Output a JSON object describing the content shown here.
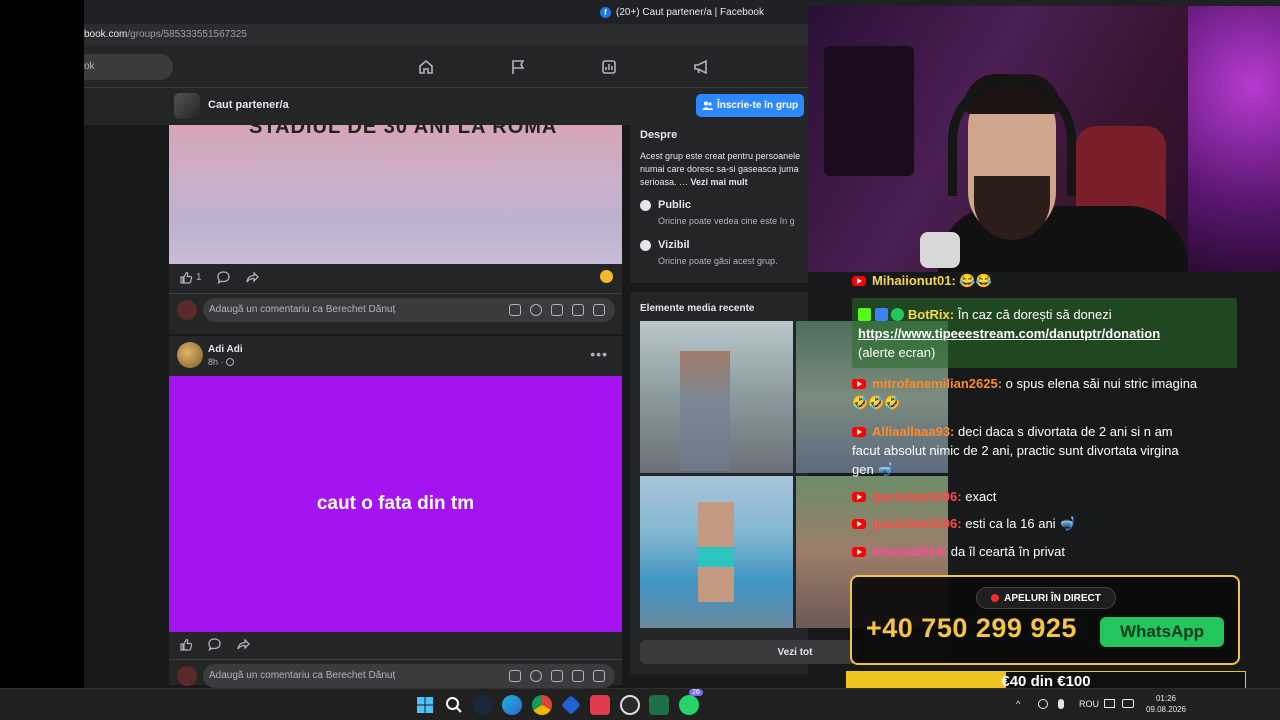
{
  "browser": {
    "tab_title": "(20+) Caut partener/a | Facebook",
    "url_host": "book.com",
    "url_path": "/groups/585333551567325",
    "search_placeholder": "ok"
  },
  "group": {
    "name": "Caut partener/a",
    "join_label": "Înscrie-te în grup"
  },
  "post1": {
    "image_caption": "STADIUL DE 30 ANI LA ROMA",
    "like_count": "1",
    "comment_placeholder": "Adaugă un comentariu ca Berechet Dănuț"
  },
  "post2": {
    "author": "Adi Adi",
    "time": "8h ·",
    "text": "caut o fata din tm",
    "comment_placeholder": "Adaugă un comentariu ca Berechet Dănuț"
  },
  "about": {
    "title": "Despre",
    "description_1": "Acest grup este creat pentru persoanele",
    "description_2": "numai care doresc sa-si gaseasca juma",
    "description_3": "serioasa. …",
    "see_more": "Vezi mai mult",
    "public_title": "Public",
    "public_text": "Oricine poate vedea cine este în g",
    "visible_title": "Vizibil",
    "visible_text": "Oricine poate găsi acest grup."
  },
  "media": {
    "title": "Elemente media recente",
    "see_all": "Vezi tot"
  },
  "chat": [
    {
      "user": "Mihaiionut01:",
      "text": "😂😂",
      "color": "#f6d84a"
    },
    {
      "user": "BotRix:",
      "text": "În caz că dorești să donezi",
      "link": "https://www.tipeeestream.com/danutptr/donation",
      "extra": "(alerte ecran)",
      "color": "#f6d84a"
    },
    {
      "user": "mitrofanemilian2625:",
      "text": "o spus elena săi nui stric imagina",
      "line2": "🤣🤣🤣",
      "color": "#ff8a2a"
    },
    {
      "user": "Alliaallaaa93:",
      "text": "deci daca s divortata de 2 ani si n am",
      "line2": "facut absolut nimic de 2 ani, practic sunt divortata virgina",
      "line3": "gen 🤿",
      "color": "#ff8a2a"
    },
    {
      "user": "gasiulian5396:",
      "text": "exact",
      "color": "#ff4a4a"
    },
    {
      "user": "gasiulian5396:",
      "text": "esti ca la 16 ani 🤿",
      "color": "#ff4a4a"
    },
    {
      "user": "bluana2014:",
      "text": "da îl ceartă în privat",
      "color": "#ff4a9a"
    }
  ],
  "overlay": {
    "live_label": "APELURI ÎN DIRECT",
    "phone": "+40 750 299 925",
    "whatsapp": "WhatsApp",
    "goal_label": "€40 din €100",
    "goal_fraction": 0.4
  },
  "taskbar": {
    "lang": "ROU",
    "time": "01:26",
    "date": "09.08.2026",
    "whatsapp_badge": "26"
  },
  "colors": {
    "fb_blue": "#2d88ff",
    "purple_post": "#a413f0",
    "overlay_gold": "#f6c445",
    "whatsapp_green": "#22c55e"
  }
}
